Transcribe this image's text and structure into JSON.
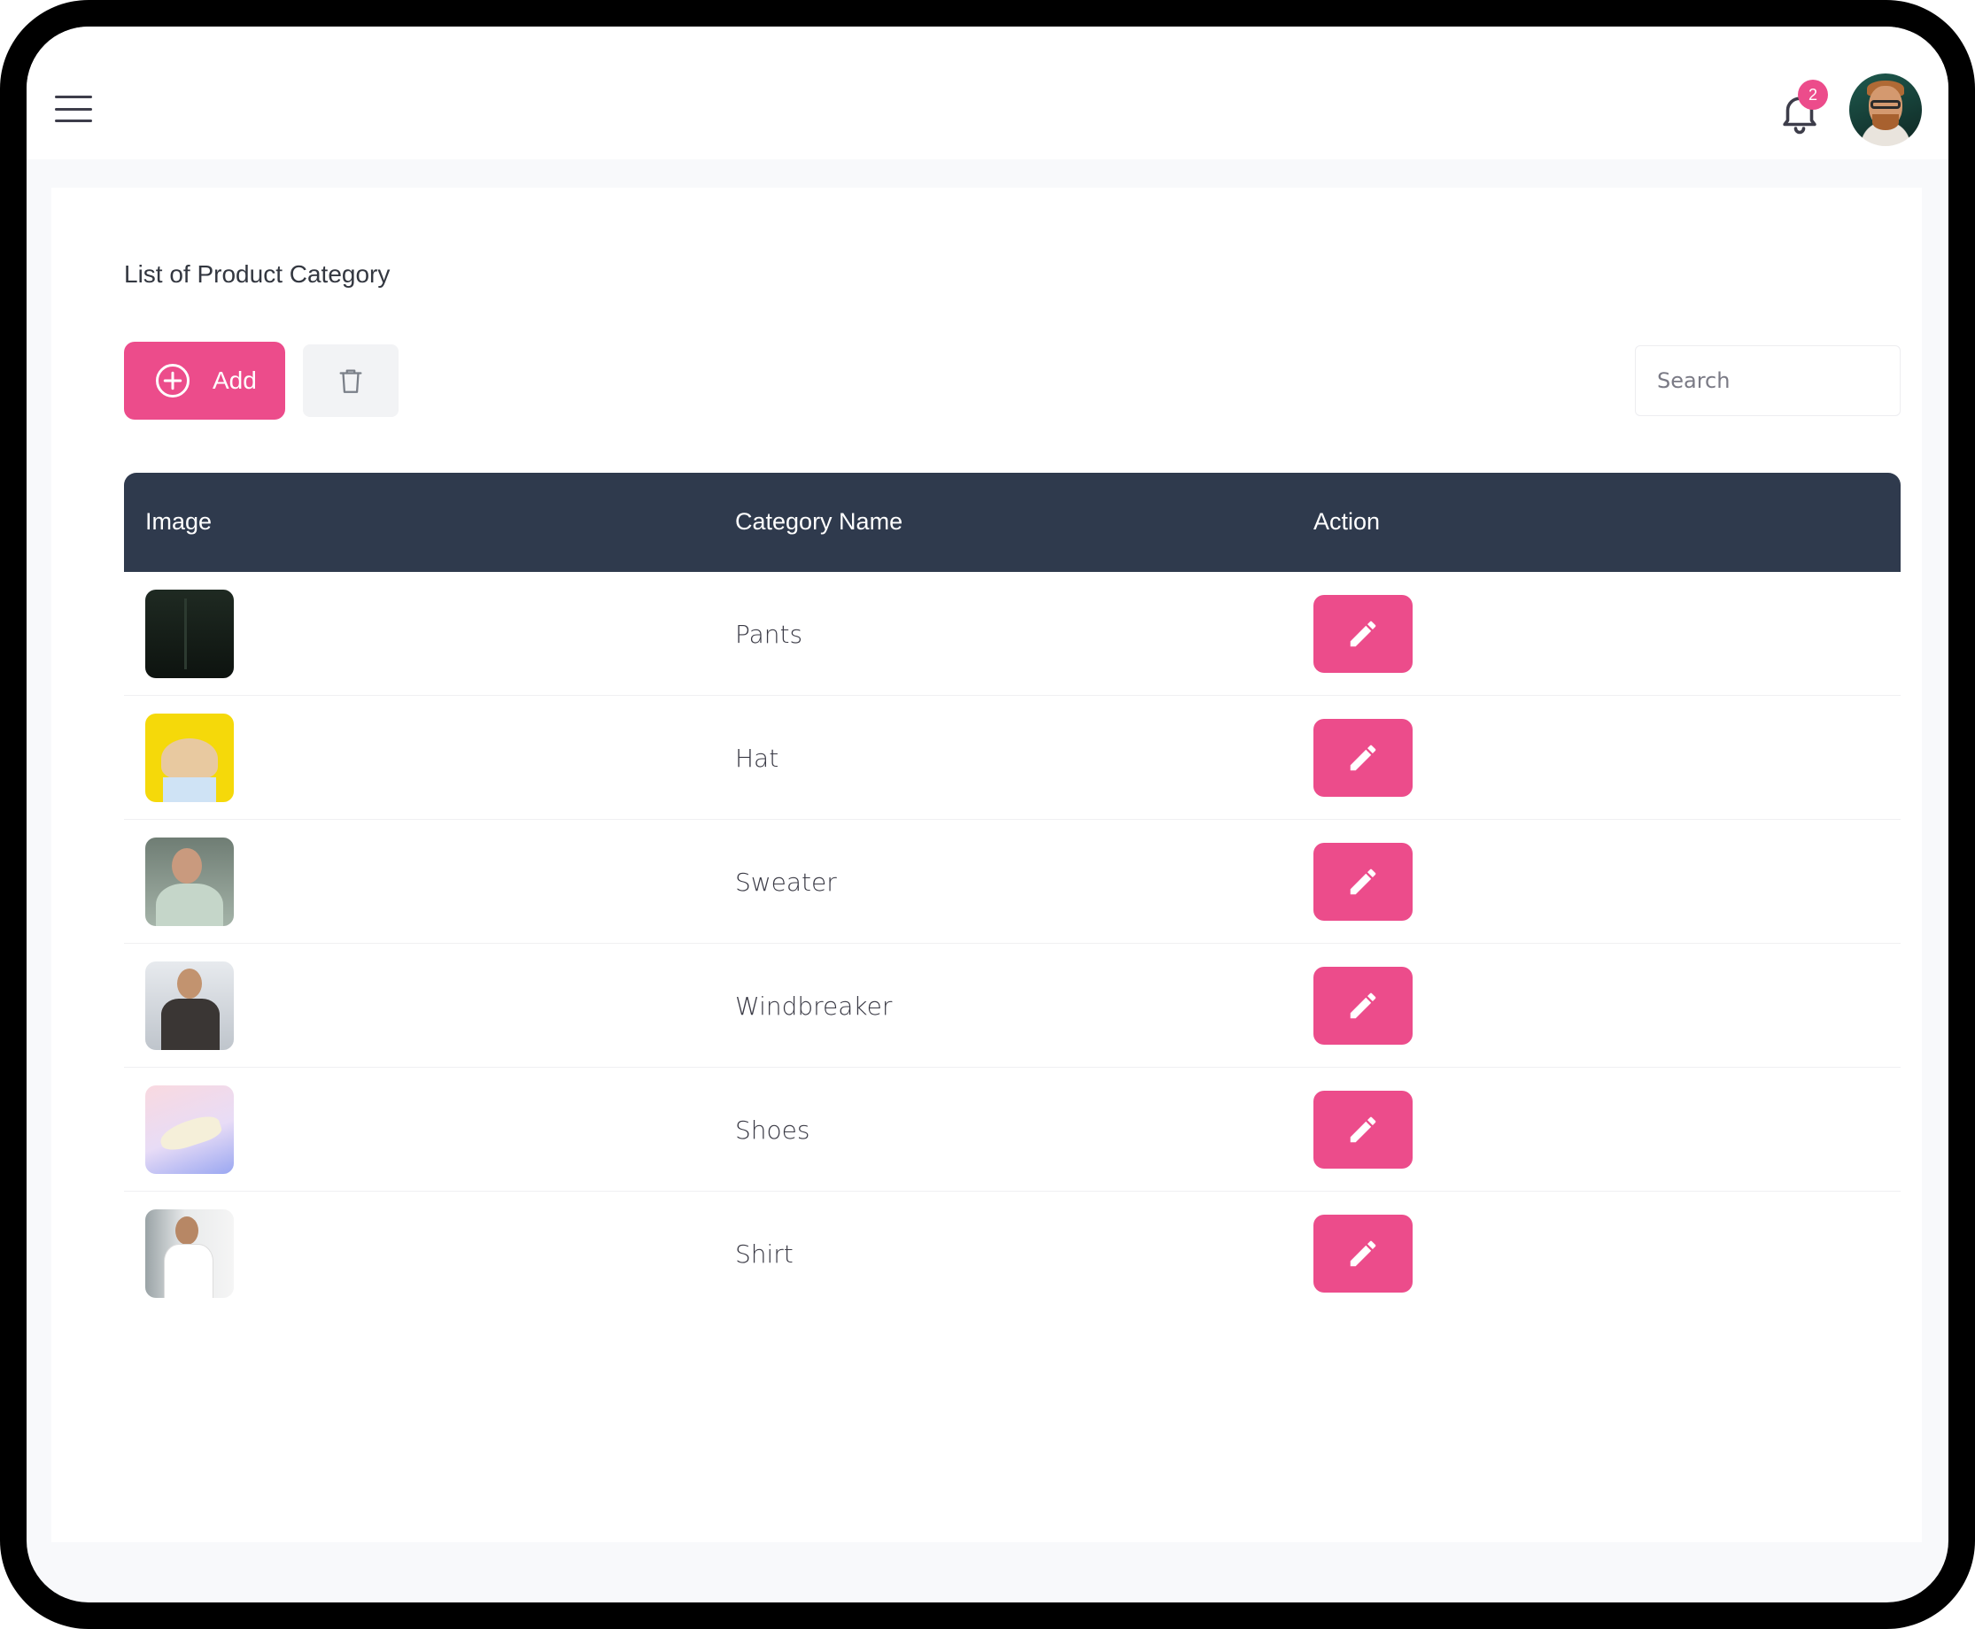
{
  "header": {
    "notification_count": "2"
  },
  "page": {
    "title": "List of Product Category"
  },
  "toolbar": {
    "add_label": "Add",
    "search_placeholder": "Search"
  },
  "table": {
    "columns": [
      "Image",
      "Category Name",
      "Action"
    ],
    "rows": [
      {
        "name": "Pants",
        "image": "pants-thumbnail"
      },
      {
        "name": "Hat",
        "image": "hat-thumbnail"
      },
      {
        "name": "Sweater",
        "image": "sweater-thumbnail"
      },
      {
        "name": "Windbreaker",
        "image": "windbreaker-thumbnail"
      },
      {
        "name": "Shoes",
        "image": "shoes-thumbnail"
      },
      {
        "name": "Shirt",
        "image": "shirt-thumbnail"
      }
    ]
  },
  "icons": {
    "menu": "hamburger-menu-icon",
    "notifications": "bell-icon",
    "add": "plus-circle-icon",
    "delete": "trash-icon",
    "edit": "pencil-icon"
  },
  "colors": {
    "accent": "#ec4c8b",
    "table_header": "#2f3a4d",
    "background": "#f8f9fb"
  }
}
